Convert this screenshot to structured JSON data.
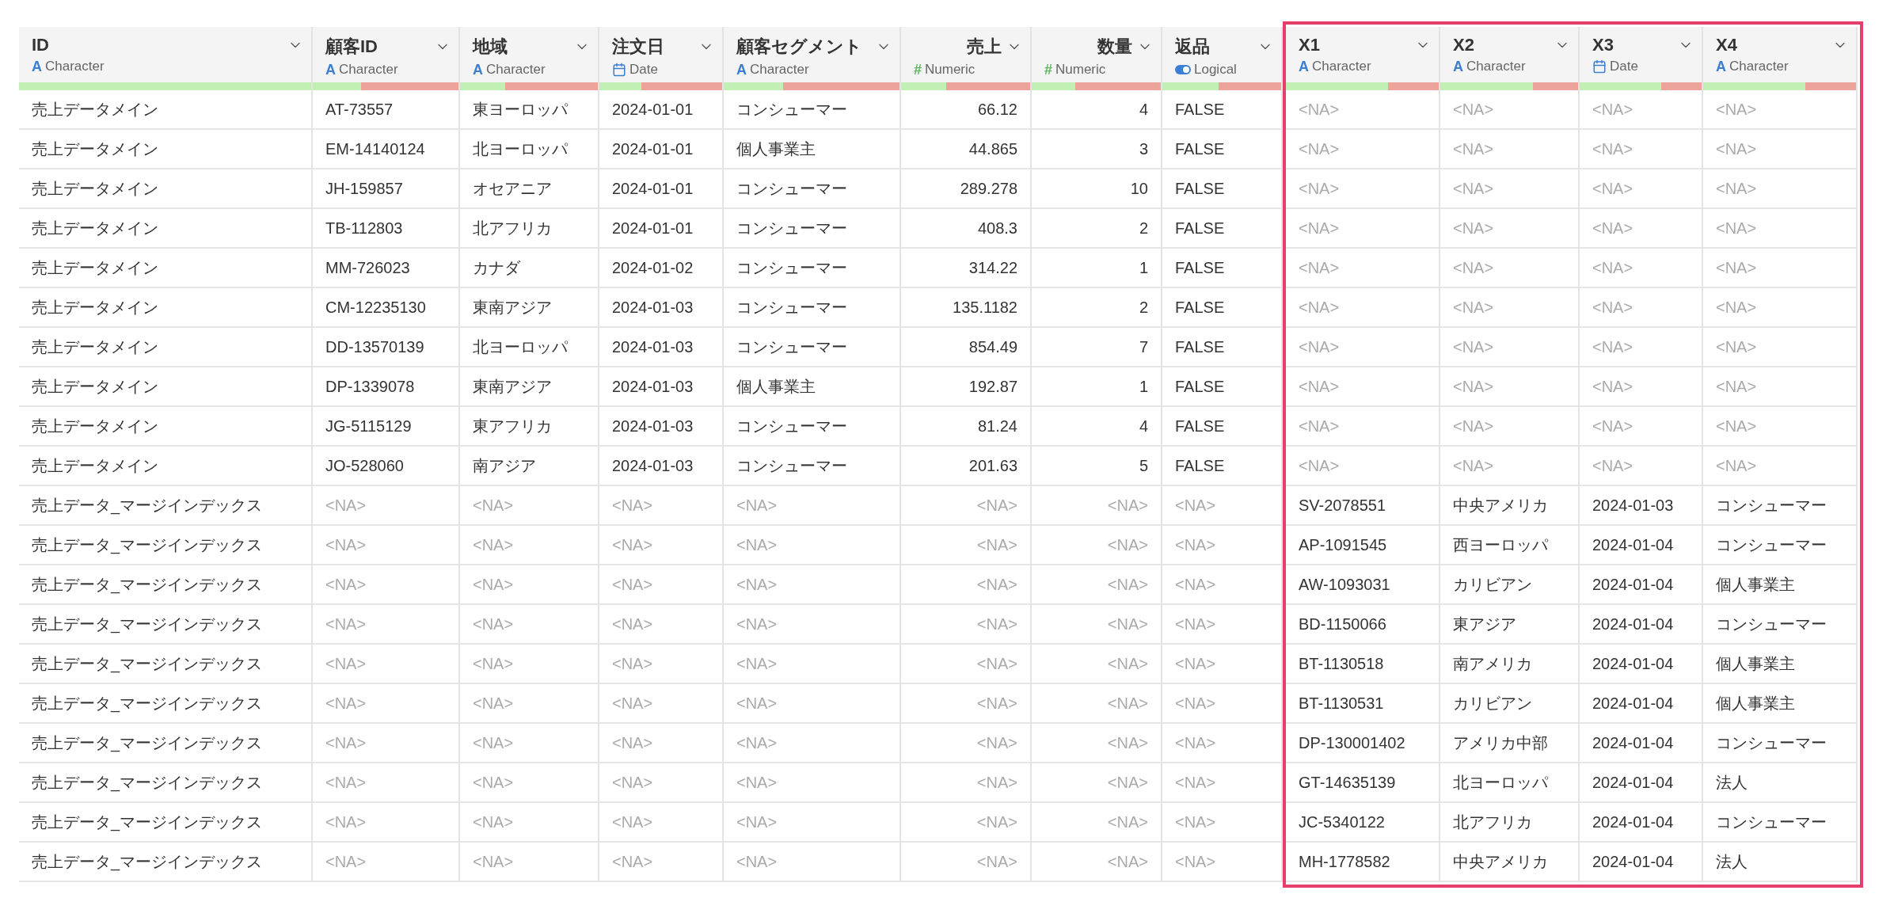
{
  "key_column": {
    "name": "ID",
    "type": "Character",
    "kind": "character",
    "type_glyph": "A",
    "level": 1
  },
  "columns": [
    {
      "name": "顧客ID",
      "type": "Character",
      "kind": "character",
      "type_glyph": "A",
      "level": 0.33
    },
    {
      "name": "地域",
      "type": "Character",
      "kind": "character",
      "type_glyph": "A",
      "level": 0.33
    },
    {
      "name": "注文日",
      "type": "Date",
      "kind": "date",
      "level": 0.34
    },
    {
      "name": "顧客セグメント",
      "type": "Character",
      "kind": "character",
      "type_glyph": "A",
      "level": 0.34
    },
    {
      "name": "売上",
      "type": "Numeric",
      "kind": "numeric",
      "type_glyph": "#",
      "level": 0.35
    },
    {
      "name": "数量",
      "type": "Numeric",
      "kind": "numeric",
      "type_glyph": "#",
      "level": 0.34
    },
    {
      "name": "返品",
      "type": "Logical",
      "kind": "logical",
      "level": 0.47
    }
  ],
  "highlighted_columns": [
    {
      "name": "X1",
      "type": "Character",
      "kind": "character",
      "type_glyph": "A",
      "level": 0.67
    },
    {
      "name": "X2",
      "type": "Character",
      "kind": "character",
      "type_glyph": "A",
      "level": 0.67
    },
    {
      "name": "X3",
      "type": "Date",
      "kind": "date",
      "level": 0.67
    },
    {
      "name": "X4",
      "type": "Character",
      "kind": "character",
      "type_glyph": "A",
      "level": 0.67
    }
  ],
  "rows": [
    {
      "key": "売上データメイン",
      "cells": [
        "AT-73557",
        "東ヨーロッパ",
        "2024-01-01",
        "コンシューマー",
        "66.12",
        "4",
        "FALSE"
      ],
      "cells_na": false,
      "highlight_cells": [
        "<NA>",
        "<NA>",
        "<NA>",
        "<NA>"
      ],
      "highlight_na": true
    },
    {
      "key": "売上データメイン",
      "cells": [
        "EM-14140124",
        "北ヨーロッパ",
        "2024-01-01",
        "個人事業主",
        "44.865",
        "3",
        "FALSE"
      ],
      "cells_na": false,
      "highlight_cells": [
        "<NA>",
        "<NA>",
        "<NA>",
        "<NA>"
      ],
      "highlight_na": true
    },
    {
      "key": "売上データメイン",
      "cells": [
        "JH-159857",
        "オセアニア",
        "2024-01-01",
        "コンシューマー",
        "289.278",
        "10",
        "FALSE"
      ],
      "cells_na": false,
      "highlight_cells": [
        "<NA>",
        "<NA>",
        "<NA>",
        "<NA>"
      ],
      "highlight_na": true
    },
    {
      "key": "売上データメイン",
      "cells": [
        "TB-112803",
        "北アフリカ",
        "2024-01-01",
        "コンシューマー",
        "408.3",
        "2",
        "FALSE"
      ],
      "cells_na": false,
      "highlight_cells": [
        "<NA>",
        "<NA>",
        "<NA>",
        "<NA>"
      ],
      "highlight_na": true
    },
    {
      "key": "売上データメイン",
      "cells": [
        "MM-726023",
        "カナダ",
        "2024-01-02",
        "コンシューマー",
        "314.22",
        "1",
        "FALSE"
      ],
      "cells_na": false,
      "highlight_cells": [
        "<NA>",
        "<NA>",
        "<NA>",
        "<NA>"
      ],
      "highlight_na": true
    },
    {
      "key": "売上データメイン",
      "cells": [
        "CM-12235130",
        "東南アジア",
        "2024-01-03",
        "コンシューマー",
        "135.1182",
        "2",
        "FALSE"
      ],
      "cells_na": false,
      "highlight_cells": [
        "<NA>",
        "<NA>",
        "<NA>",
        "<NA>"
      ],
      "highlight_na": true
    },
    {
      "key": "売上データメイン",
      "cells": [
        "DD-13570139",
        "北ヨーロッパ",
        "2024-01-03",
        "コンシューマー",
        "854.49",
        "7",
        "FALSE"
      ],
      "cells_na": false,
      "highlight_cells": [
        "<NA>",
        "<NA>",
        "<NA>",
        "<NA>"
      ],
      "highlight_na": true
    },
    {
      "key": "売上データメイン",
      "cells": [
        "DP-1339078",
        "東南アジア",
        "2024-01-03",
        "個人事業主",
        "192.87",
        "1",
        "FALSE"
      ],
      "cells_na": false,
      "highlight_cells": [
        "<NA>",
        "<NA>",
        "<NA>",
        "<NA>"
      ],
      "highlight_na": true
    },
    {
      "key": "売上データメイン",
      "cells": [
        "JG-5115129",
        "東アフリカ",
        "2024-01-03",
        "コンシューマー",
        "81.24",
        "4",
        "FALSE"
      ],
      "cells_na": false,
      "highlight_cells": [
        "<NA>",
        "<NA>",
        "<NA>",
        "<NA>"
      ],
      "highlight_na": true
    },
    {
      "key": "売上データメイン",
      "cells": [
        "JO-528060",
        "南アジア",
        "2024-01-03",
        "コンシューマー",
        "201.63",
        "5",
        "FALSE"
      ],
      "cells_na": false,
      "highlight_cells": [
        "<NA>",
        "<NA>",
        "<NA>",
        "<NA>"
      ],
      "highlight_na": true
    },
    {
      "key": "売上データ_マージインデックス",
      "cells": [
        "<NA>",
        "<NA>",
        "<NA>",
        "<NA>",
        "<NA>",
        "<NA>",
        "<NA>"
      ],
      "cells_na": true,
      "highlight_cells": [
        "SV-2078551",
        "中央アメリカ",
        "2024-01-03",
        "コンシューマー"
      ],
      "highlight_na": false
    },
    {
      "key": "売上データ_マージインデックス",
      "cells": [
        "<NA>",
        "<NA>",
        "<NA>",
        "<NA>",
        "<NA>",
        "<NA>",
        "<NA>"
      ],
      "cells_na": true,
      "highlight_cells": [
        "AP-1091545",
        "西ヨーロッパ",
        "2024-01-04",
        "コンシューマー"
      ],
      "highlight_na": false
    },
    {
      "key": "売上データ_マージインデックス",
      "cells": [
        "<NA>",
        "<NA>",
        "<NA>",
        "<NA>",
        "<NA>",
        "<NA>",
        "<NA>"
      ],
      "cells_na": true,
      "highlight_cells": [
        "AW-1093031",
        "カリビアン",
        "2024-01-04",
        "個人事業主"
      ],
      "highlight_na": false
    },
    {
      "key": "売上データ_マージインデックス",
      "cells": [
        "<NA>",
        "<NA>",
        "<NA>",
        "<NA>",
        "<NA>",
        "<NA>",
        "<NA>"
      ],
      "cells_na": true,
      "highlight_cells": [
        "BD-1150066",
        "東アジア",
        "2024-01-04",
        "コンシューマー"
      ],
      "highlight_na": false
    },
    {
      "key": "売上データ_マージインデックス",
      "cells": [
        "<NA>",
        "<NA>",
        "<NA>",
        "<NA>",
        "<NA>",
        "<NA>",
        "<NA>"
      ],
      "cells_na": true,
      "highlight_cells": [
        "BT-1130518",
        "南アメリカ",
        "2024-01-04",
        "個人事業主"
      ],
      "highlight_na": false
    },
    {
      "key": "売上データ_マージインデックス",
      "cells": [
        "<NA>",
        "<NA>",
        "<NA>",
        "<NA>",
        "<NA>",
        "<NA>",
        "<NA>"
      ],
      "cells_na": true,
      "highlight_cells": [
        "BT-1130531",
        "カリビアン",
        "2024-01-04",
        "個人事業主"
      ],
      "highlight_na": false
    },
    {
      "key": "売上データ_マージインデックス",
      "cells": [
        "<NA>",
        "<NA>",
        "<NA>",
        "<NA>",
        "<NA>",
        "<NA>",
        "<NA>"
      ],
      "cells_na": true,
      "highlight_cells": [
        "DP-130001402",
        "アメリカ中部",
        "2024-01-04",
        "コンシューマー"
      ],
      "highlight_na": false
    },
    {
      "key": "売上データ_マージインデックス",
      "cells": [
        "<NA>",
        "<NA>",
        "<NA>",
        "<NA>",
        "<NA>",
        "<NA>",
        "<NA>"
      ],
      "cells_na": true,
      "highlight_cells": [
        "GT-14635139",
        "北ヨーロッパ",
        "2024-01-04",
        "法人"
      ],
      "highlight_na": false
    },
    {
      "key": "売上データ_マージインデックス",
      "cells": [
        "<NA>",
        "<NA>",
        "<NA>",
        "<NA>",
        "<NA>",
        "<NA>",
        "<NA>"
      ],
      "cells_na": true,
      "highlight_cells": [
        "JC-5340122",
        "北アフリカ",
        "2024-01-04",
        "コンシューマー"
      ],
      "highlight_na": false
    },
    {
      "key": "売上データ_マージインデックス",
      "cells": [
        "<NA>",
        "<NA>",
        "<NA>",
        "<NA>",
        "<NA>",
        "<NA>",
        "<NA>"
      ],
      "cells_na": true,
      "highlight_cells": [
        "MH-1778582",
        "中央アメリカ",
        "2024-01-04",
        "法人"
      ],
      "highlight_na": false
    }
  ]
}
